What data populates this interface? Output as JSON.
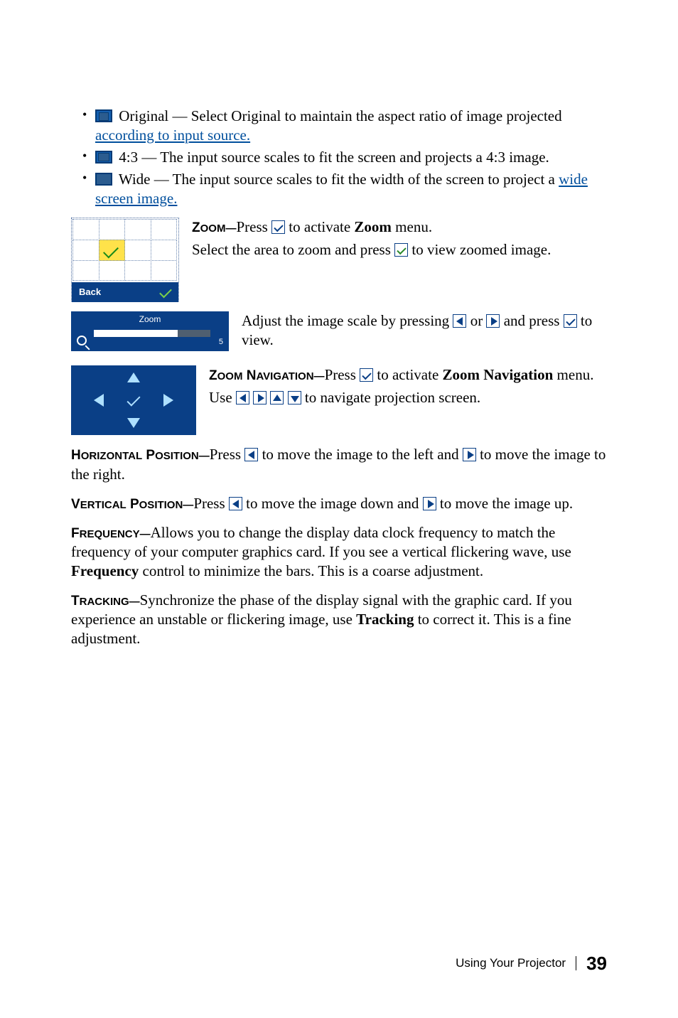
{
  "bullets": {
    "original": {
      "label": " Original — Select Original to maintain the aspect ratio of image projected ",
      "link_part": "according to input source."
    },
    "fourthree": {
      "label": " 4:3 — The input source scales to fit the screen and projects a 4:3 image."
    },
    "wide": {
      "label": " Wide — The input source scales to fit the width of the screen to project a ",
      "link_part": "wide screen image."
    }
  },
  "zoom_menu": {
    "title_sc": "Z",
    "title_rest": "OOM—",
    "desc1a": "Press ",
    "desc1b": " to activate ",
    "desc1_bold": "Zoom",
    "desc1c": " menu.",
    "desc2a": "Select the area to zoom and press ",
    "desc2b": " to view zoomed image.",
    "back_label": "Back"
  },
  "zoom_bar": {
    "label": "Zoom",
    "value": "5",
    "desc_a": "Adjust the image scale by pressing ",
    "desc_b": " or ",
    "desc_c": " and press ",
    "desc_d": " to view."
  },
  "zoom_nav": {
    "title1": "Z",
    "title2": "OOM",
    "title3": " N",
    "title4": "AVIGATION—",
    "desc1a": "Press ",
    "desc1b": " to activate ",
    "desc1_bold": "Zoom Navigation",
    "desc1c": " menu.",
    "desc2a": "Use ",
    "desc2b": " to navigate projection screen."
  },
  "hpos": {
    "t1": "H",
    "t2": "ORIZONTAL",
    "t3": " P",
    "t4": "OSITION—",
    "a": "Press ",
    "b": " to move the image to the left and ",
    "c": " to move the image to the right."
  },
  "vpos": {
    "t1": "V",
    "t2": "ERTICAL",
    "t3": " P",
    "t4": "OSITION—",
    "a": "Press ",
    "b": " to move the image down and ",
    "c": " to move the image up."
  },
  "freq": {
    "t1": "F",
    "t2": "REQUENCY—",
    "body1": "Allows you to change the display data clock frequency to match the frequency of your computer graphics card. If you see a vertical flickering wave, use ",
    "bold": "Frequency",
    "body2": " control to minimize the bars. This is a coarse adjustment."
  },
  "track": {
    "t1": "T",
    "t2": "RACKING—",
    "body1": "Synchronize the phase of the display signal with the graphic card. If you experience an unstable or flickering image, use ",
    "bold": "Tracking",
    "body2": " to correct it. This is a fine adjustment."
  },
  "footer": {
    "section": "Using Your Projector",
    "page": "39"
  }
}
